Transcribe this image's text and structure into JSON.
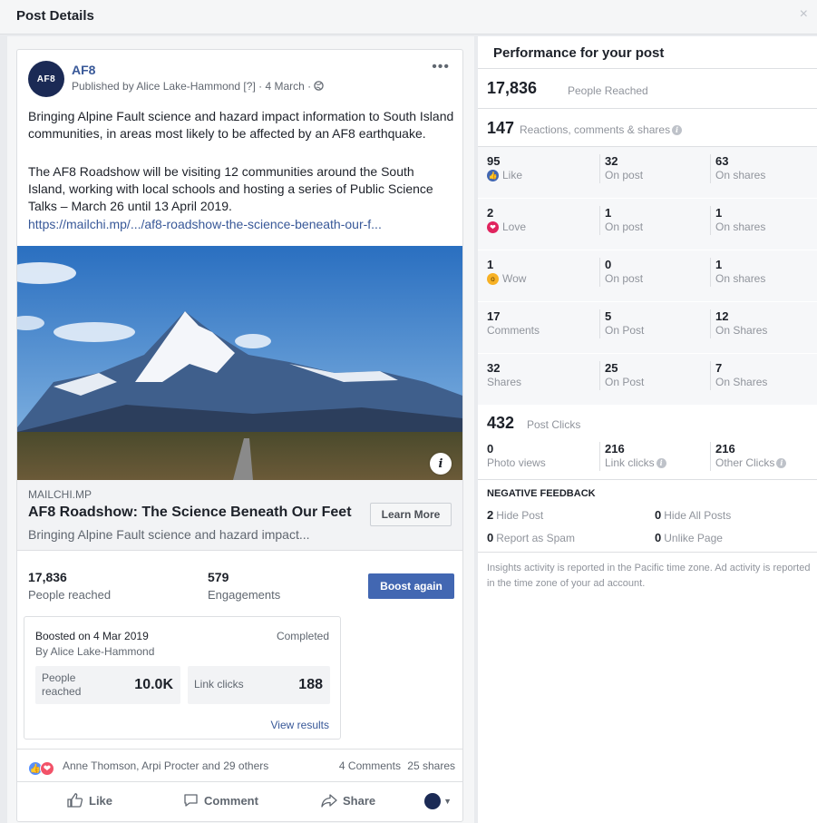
{
  "dialog": {
    "title": "Post Details",
    "close_label": "×"
  },
  "post": {
    "avatar_text": "AF8",
    "page_name": "AF8",
    "meta": "Published by Alice Lake-Hammond [?] · 4 March · ",
    "paragraph1": "Bringing Alpine Fault science and hazard impact information to South Island communities, in areas most likely to be affected by an AF8 earthquake.",
    "paragraph2": "The AF8 Roadshow will be visiting 12 communities around the South Island, working with local schools and hosting a series of Public Science Talks – March 26 until 13 April 2019.",
    "link": "https://mailchi.mp/.../af8-roadshow-the-science-beneath-our-f...",
    "more_label": "•••",
    "info_label": "i"
  },
  "link_preview": {
    "domain": "MAILCHI.MP",
    "title": "AF8 Roadshow: The Science Beneath Our Feet",
    "description": "Bringing Alpine Fault science and hazard impact...",
    "button": "Learn More"
  },
  "stats": {
    "reached_value": "17,836",
    "reached_label": "People reached",
    "engagements_value": "579",
    "engagements_label": "Engagements",
    "boost_button": "Boost again"
  },
  "boost": {
    "date": "Boosted on 4 Mar 2019",
    "by": "By Alice Lake-Hammond",
    "status": "Completed",
    "people_label": "People reached",
    "people_value": "10.0K",
    "clicks_label": "Link clicks",
    "clicks_value": "188",
    "view_results": "View results"
  },
  "social": {
    "names": "Anne Thomson, Arpi Procter and 29 others",
    "comments": "4 Comments",
    "shares": "25 shares"
  },
  "actions": {
    "like": "Like",
    "comment": "Comment",
    "share": "Share"
  },
  "performance": {
    "title": "Performance for your post",
    "reached_value": "17,836",
    "reached_label": "People Reached",
    "reactions_value": "147",
    "reactions_label": "Reactions, comments & shares",
    "rows": [
      {
        "v1": "95",
        "l1": "Like",
        "v2": "32",
        "l2": "On post",
        "v3": "63",
        "l3": "On shares"
      },
      {
        "v1": "2",
        "l1": "Love",
        "v2": "1",
        "l2": "On post",
        "v3": "1",
        "l3": "On shares"
      },
      {
        "v1": "1",
        "l1": "Wow",
        "v2": "0",
        "l2": "On post",
        "v3": "1",
        "l3": "On shares"
      },
      {
        "v1": "17",
        "l1": "Comments",
        "v2": "5",
        "l2": "On Post",
        "v3": "12",
        "l3": "On Shares"
      },
      {
        "v1": "32",
        "l1": "Shares",
        "v2": "25",
        "l2": "On Post",
        "v3": "7",
        "l3": "On Shares"
      }
    ],
    "clicks_value": "432",
    "clicks_label": "Post Clicks",
    "click_cells": [
      {
        "v": "0",
        "l": "Photo views"
      },
      {
        "v": "216",
        "l": "Link clicks"
      },
      {
        "v": "216",
        "l": "Other Clicks"
      }
    ],
    "negative_title": "NEGATIVE FEEDBACK",
    "negative": [
      {
        "v": "2",
        "l": "Hide Post"
      },
      {
        "v": "0",
        "l": "Hide All Posts"
      },
      {
        "v": "0",
        "l": "Report as Spam"
      },
      {
        "v": "0",
        "l": "Unlike Page"
      }
    ],
    "footnote": "Insights activity is reported in the Pacific time zone. Ad activity is reported in the time zone of your ad account."
  },
  "colors": {
    "brand_blue": "#4267b2",
    "link_blue": "#385898",
    "love_red": "#e0245e",
    "wow_yellow": "#f7b125"
  }
}
